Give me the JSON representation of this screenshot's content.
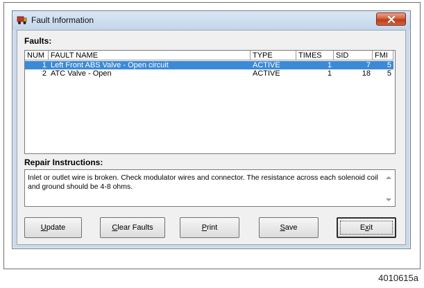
{
  "window": {
    "title": "Fault Information",
    "icon": "truck-icon",
    "close_icon": "close-icon",
    "accent_color": "#3c8ad6",
    "close_color": "#c8472a"
  },
  "faults": {
    "label": "Faults:",
    "columns": [
      "NUM",
      "FAULT NAME",
      "TYPE",
      "TIMES",
      "SID",
      "FMI"
    ],
    "rows": [
      {
        "num": "1",
        "name": "Left Front ABS Valve - Open circuit",
        "type": "ACTIVE",
        "times": "1",
        "sid": "7",
        "fmi": "5",
        "selected": true
      },
      {
        "num": "2",
        "name": "ATC Valve - Open",
        "type": "ACTIVE",
        "times": "1",
        "sid": "18",
        "fmi": "5",
        "selected": false
      }
    ]
  },
  "repair": {
    "label": "Repair Instructions:",
    "text": "Inlet or outlet wire is broken.  Check modulator wires and connector.  The resistance across each solenoid coil and ground should be 4-8 ohms."
  },
  "buttons": {
    "update": {
      "pre": "",
      "key": "U",
      "post": "pdate"
    },
    "clear": {
      "pre": "",
      "key": "C",
      "post": "lear Faults"
    },
    "print": {
      "pre": "",
      "key": "P",
      "post": "rint"
    },
    "save": {
      "pre": "",
      "key": "S",
      "post": "ave"
    },
    "exit": {
      "pre": "E",
      "key": "x",
      "post": "it"
    }
  },
  "figure_id": "4010615a"
}
